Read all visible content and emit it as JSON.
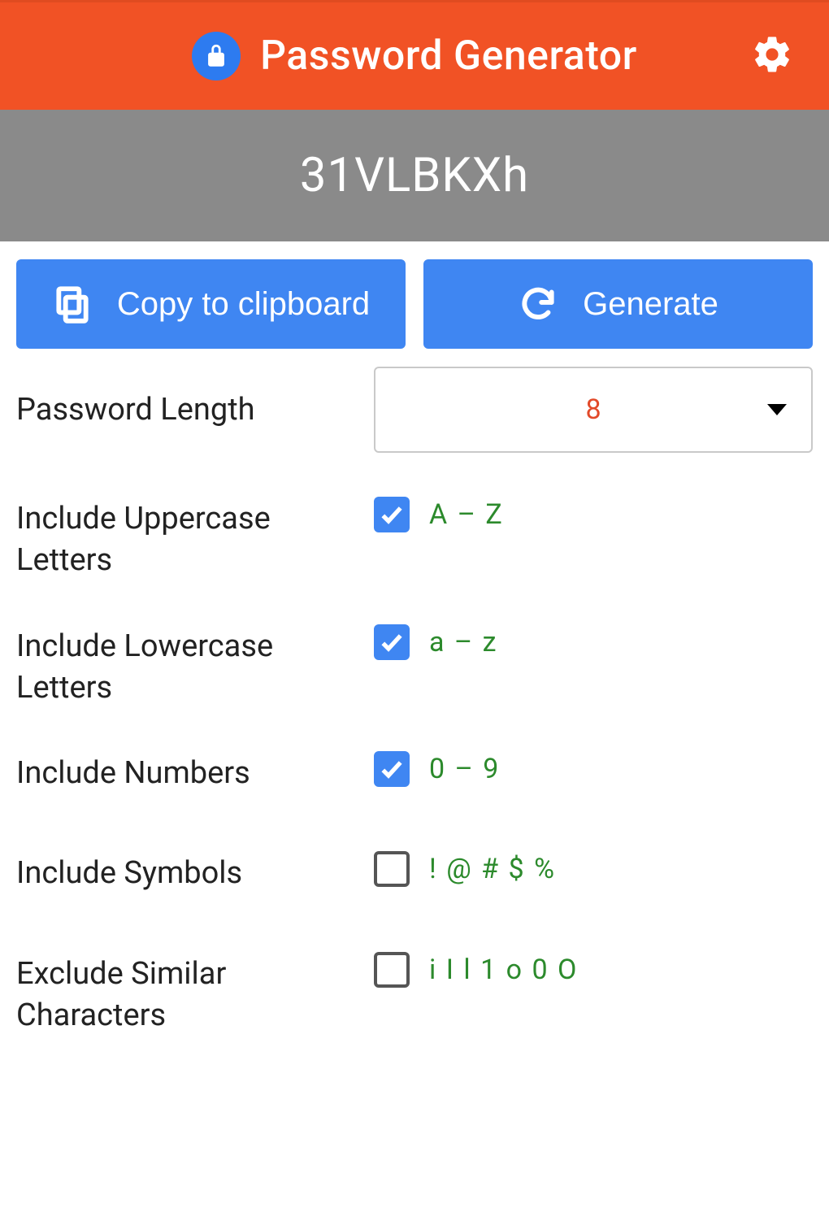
{
  "header": {
    "title": "Password Generator"
  },
  "password": "31VLBKXh",
  "buttons": {
    "copy": "Copy to clipboard",
    "generate": "Generate"
  },
  "length": {
    "label": "Password Length",
    "value": "8"
  },
  "options": {
    "uppercase": {
      "label": "Include Uppercase Letters",
      "hint": "A – Z",
      "checked": true
    },
    "lowercase": {
      "label": "Include Lowercase Letters",
      "hint": "a – z",
      "checked": true
    },
    "numbers": {
      "label": "Include Numbers",
      "hint": "0 – 9",
      "checked": true
    },
    "symbols": {
      "label": "Include Symbols",
      "hint": "! @ # $ %",
      "checked": false
    },
    "similar": {
      "label": "Exclude Similar Characters",
      "hint": "i I l 1 o 0 O",
      "checked": false
    }
  }
}
